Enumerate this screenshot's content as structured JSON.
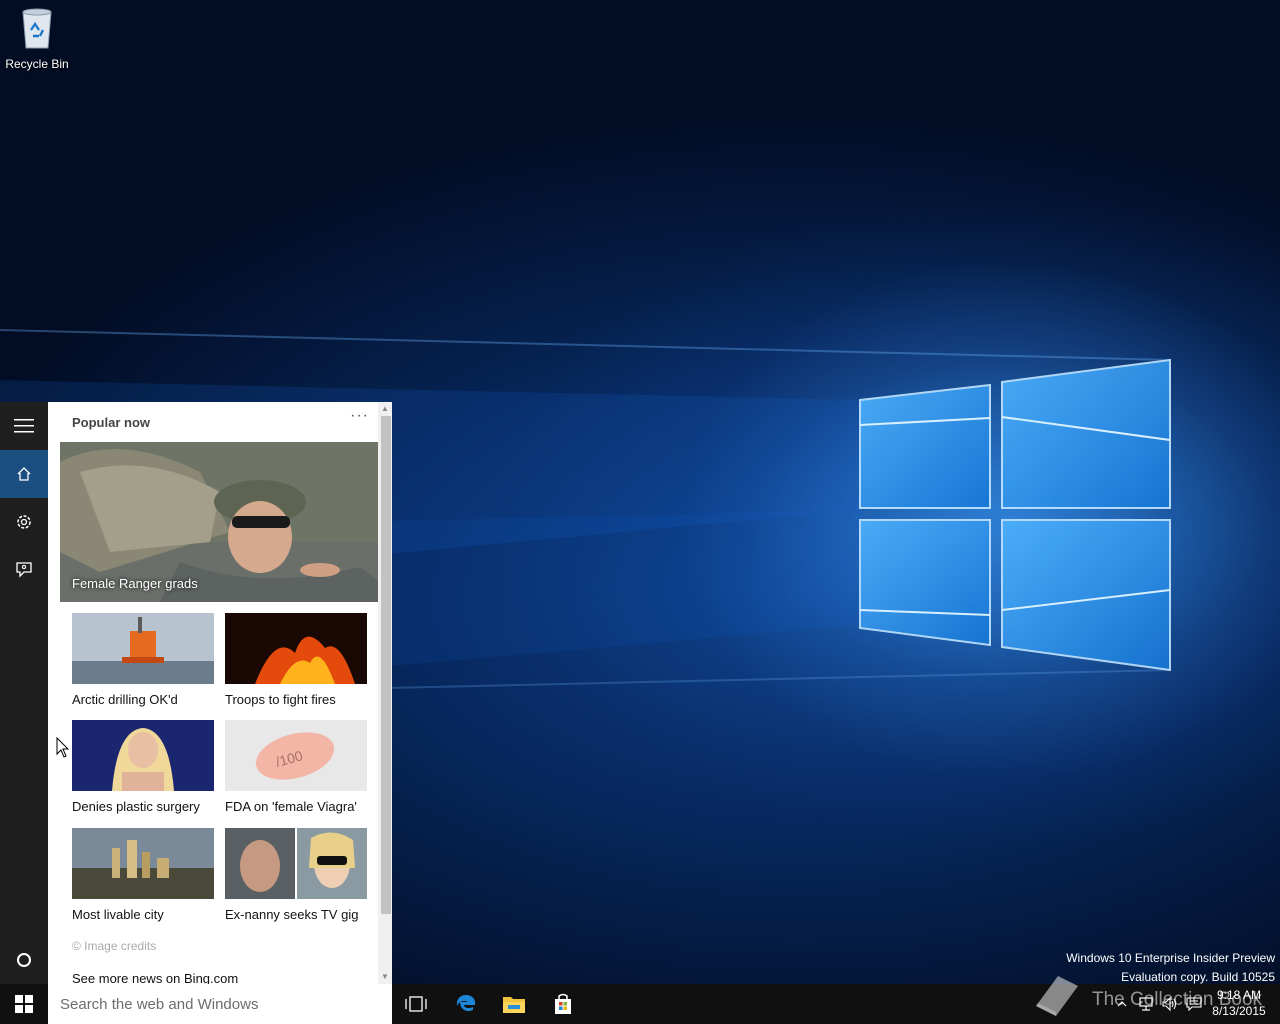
{
  "desktop": {
    "icons": [
      {
        "label": "Recycle Bin",
        "icon": "recycle-bin-icon"
      }
    ],
    "watermark": {
      "line1": "Windows 10 Enterprise Insider Preview",
      "line2": "Evaluation copy. Build 10525"
    },
    "site_watermark": "The Collection Book"
  },
  "start_panel": {
    "rail": [
      {
        "name": "menu-icon",
        "active": false
      },
      {
        "name": "home-icon",
        "active": true
      },
      {
        "name": "gear-icon",
        "active": false
      },
      {
        "name": "feedback-icon",
        "active": false
      },
      {
        "name": "cortana-circle-icon",
        "active": false
      }
    ],
    "title": "Popular now",
    "more": "···",
    "hero": {
      "caption": "Female Ranger grads"
    },
    "tiles": [
      {
        "caption": "Arctic drilling OK'd"
      },
      {
        "caption": "Troops to fight fires"
      },
      {
        "caption": "Denies plastic surgery"
      },
      {
        "caption": "FDA on 'female Viagra'"
      },
      {
        "caption": "Most livable city"
      },
      {
        "caption": "Ex-nanny seeks TV gig"
      }
    ],
    "credits": "© Image credits",
    "more_news": "See more news on Bing.com"
  },
  "taskbar": {
    "search_placeholder": "Search the web and Windows",
    "pinned": [
      "task-view-icon",
      "edge-icon",
      "file-explorer-icon",
      "store-icon"
    ],
    "tray": [
      "chevron-up-icon",
      "network-icon",
      "volume-icon",
      "action-center-icon"
    ],
    "time": "9:18 AM",
    "date": "8/13/2015"
  },
  "colors": {
    "rail_bg": "#1f1f1f",
    "rail_active": "#1b4f80",
    "taskbar": "#101010",
    "desktop_accent": "#1e90ff"
  }
}
